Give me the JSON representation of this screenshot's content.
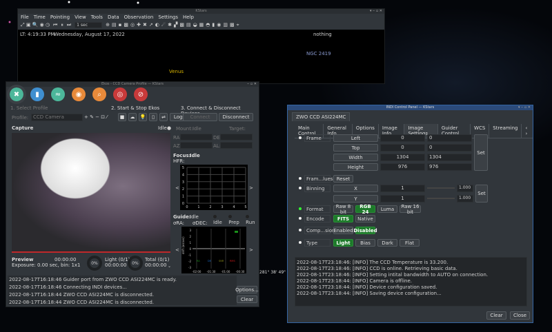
{
  "kstars": {
    "title": "KStars",
    "menu": [
      "File",
      "Time",
      "Pointing",
      "View",
      "Tools",
      "Data",
      "Observation",
      "Settings",
      "Help"
    ],
    "time_step": "1 sec",
    "status_time": "LT: 4:19:33 PM",
    "status_date": "Wednesday, August 17, 2022",
    "status_object": "nothing",
    "labels": {
      "venus": "Venus",
      "ngc": "NGC 2419"
    },
    "coords": "281° 38' 49\""
  },
  "ekos": {
    "title": "Ekos - CCD Camera Profile — KStars",
    "tabs": [
      {
        "name": "setup",
        "color": "#4cb79a"
      },
      {
        "name": "scheduler",
        "color": "#3f8fd0"
      },
      {
        "name": "analyze",
        "color": "#4cb79a"
      },
      {
        "name": "capture",
        "color": "#e88a3a"
      },
      {
        "name": "focus",
        "color": "#e88a3a"
      },
      {
        "name": "align",
        "color": "#c83a3a"
      },
      {
        "name": "guide",
        "color": "#c83a3a"
      }
    ],
    "step1": "1. Select Profile",
    "step2": "2. Start & Stop Ekos",
    "step3": "3. Connect & Disconnect Devices",
    "profile_label": "Profile:",
    "profile_value": "CCD Camera",
    "logs": "Logs",
    "connect": "Connect",
    "disconnect": "Disconnect",
    "capture_title": "Capture",
    "capture_status": "Idle",
    "mount_label": "Mount:",
    "mount_status": "Idle",
    "target_label": "Target:",
    "ra": "RA:",
    "de": "DE:",
    "az": "AZ:",
    "al": "AL:",
    "focus_label": "Focus:",
    "focus_status": "Idle",
    "hfr": "HFR:",
    "focus_x_ticks": [
      "0",
      "1",
      "2",
      "3",
      "4",
      "5"
    ],
    "focus_y_ticks": [
      "5",
      "4",
      "3",
      "2",
      "1",
      "0"
    ],
    "guide_label": "Guide:",
    "guide_status": "Idle",
    "guide_states": [
      "Idle",
      "Prep",
      "Run"
    ],
    "dra": "σRA:",
    "ddec": "σDEC:",
    "guide_x_ticks": [
      "-02:00",
      "-01:30",
      "-01:00",
      "-00:30"
    ],
    "guide_y_ticks": [
      "3",
      "2",
      "1",
      "0",
      "-1",
      "-2",
      "-3"
    ],
    "guide_ylabel": "drift (arcsec)",
    "guide_legend": [
      "RA",
      "DE",
      "SNR",
      "RMS"
    ],
    "preview": "Preview",
    "preview_time": "00:00:00",
    "exposure": "Exposure: 0.00 sec, bin: 1x1",
    "light_pct": "0%",
    "light": "Light (0/1)",
    "light_time": "00:00:00",
    "total_pct": "0%",
    "total": "Total (0/1)",
    "total_time": "00:00:00",
    "log": [
      "2022-08-17T16:18:46 Guider port from ZWO CCD ASI224MC is ready.",
      "2022-08-17T16:18:46 Connecting INDI devices...",
      "2022-08-17T16:18:44 ZWO CCD ASI224MC is disconnected.",
      "2022-08-17T16:18:44 ZWO CCD ASI224MC is disconnected."
    ],
    "options": "Options...",
    "clear": "Clear"
  },
  "indi": {
    "title": "INDI Control Panel — KStars",
    "device": "ZWO CCD ASI224MC",
    "tabs": [
      "Main Control",
      "General Info",
      "Options",
      "Image Info",
      "Image Settings",
      "Guider Control",
      "WCS",
      "Streaming"
    ],
    "active_tab": "Image Settings",
    "frame": {
      "label": "Frame",
      "rows": [
        [
          "Left",
          "0",
          "0"
        ],
        [
          "Top",
          "0",
          "0"
        ],
        [
          "Width",
          "1304",
          "1304"
        ],
        [
          "Height",
          "976",
          "976"
        ]
      ],
      "set": "Set"
    },
    "frame_values": {
      "label": "Fram...lues",
      "reset": "Reset"
    },
    "binning": {
      "label": "Binning",
      "rows": [
        [
          "X",
          "1",
          "1.000"
        ],
        [
          "Y",
          "1",
          "1.000"
        ]
      ],
      "set": "Set"
    },
    "format": {
      "label": "Format",
      "options": [
        "Raw 8 bit",
        "RGB 24",
        "Luma",
        "Raw 16 bit"
      ],
      "active": "RGB 24"
    },
    "encode": {
      "label": "Encode",
      "options": [
        "FITS",
        "Native"
      ],
      "active": "FITS"
    },
    "compression": {
      "label": "Comp...sion",
      "options": [
        "Enabled",
        "Disabled"
      ],
      "active": "Disabled"
    },
    "type": {
      "label": "Type",
      "options": [
        "Light",
        "Bias",
        "Dark",
        "Flat"
      ],
      "active": "Light"
    },
    "log": [
      "2022-08-17T23:18:46: [INFO] The CCD Temperature is 33.200.",
      "2022-08-17T23:18:46: [INFO] CCD is online. Retrieving basic data.",
      "2022-08-17T23:18:46: [INFO] Setting intital bandwidth to AUTO on connection.",
      "2022-08-17T23:18:44: [INFO] Camera is offline.",
      "2022-08-17T23:18:44: [INFO] Device configuration saved.",
      "2022-08-17T23:18:44: [INFO] Saving device configuration..."
    ],
    "clear": "Clear",
    "close": "Close"
  }
}
